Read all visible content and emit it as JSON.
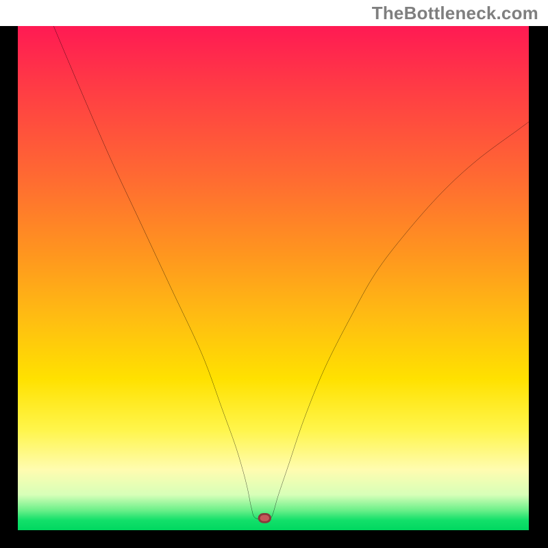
{
  "watermark": "TheBottleneck.com",
  "chart_data": {
    "type": "line",
    "title": "",
    "xlabel": "",
    "ylabel": "",
    "xlim": [
      0,
      100
    ],
    "ylim": [
      0,
      100
    ],
    "grid": false,
    "series": [
      {
        "name": "curve",
        "x": [
          7,
          12,
          18,
          24,
          30,
          36,
          40,
          42.5,
          44,
          45,
          45.7,
          46.5,
          49,
          49.5,
          50,
          51,
          53,
          56,
          60,
          65,
          70,
          76,
          83,
          90,
          98,
          100
        ],
        "values": [
          100,
          88,
          74,
          61,
          48,
          35,
          24,
          17,
          12,
          8,
          4.5,
          2.4,
          2.4,
          2.4,
          3.5,
          7,
          13,
          22,
          32,
          42,
          51,
          59,
          67,
          73.5,
          79.5,
          81
        ]
      }
    ],
    "marker": {
      "x": 48.3,
      "y": 2.4
    },
    "background_gradient": {
      "top": "#ff1a53",
      "mid": "#ffe100",
      "bottom": "#00d860"
    }
  }
}
